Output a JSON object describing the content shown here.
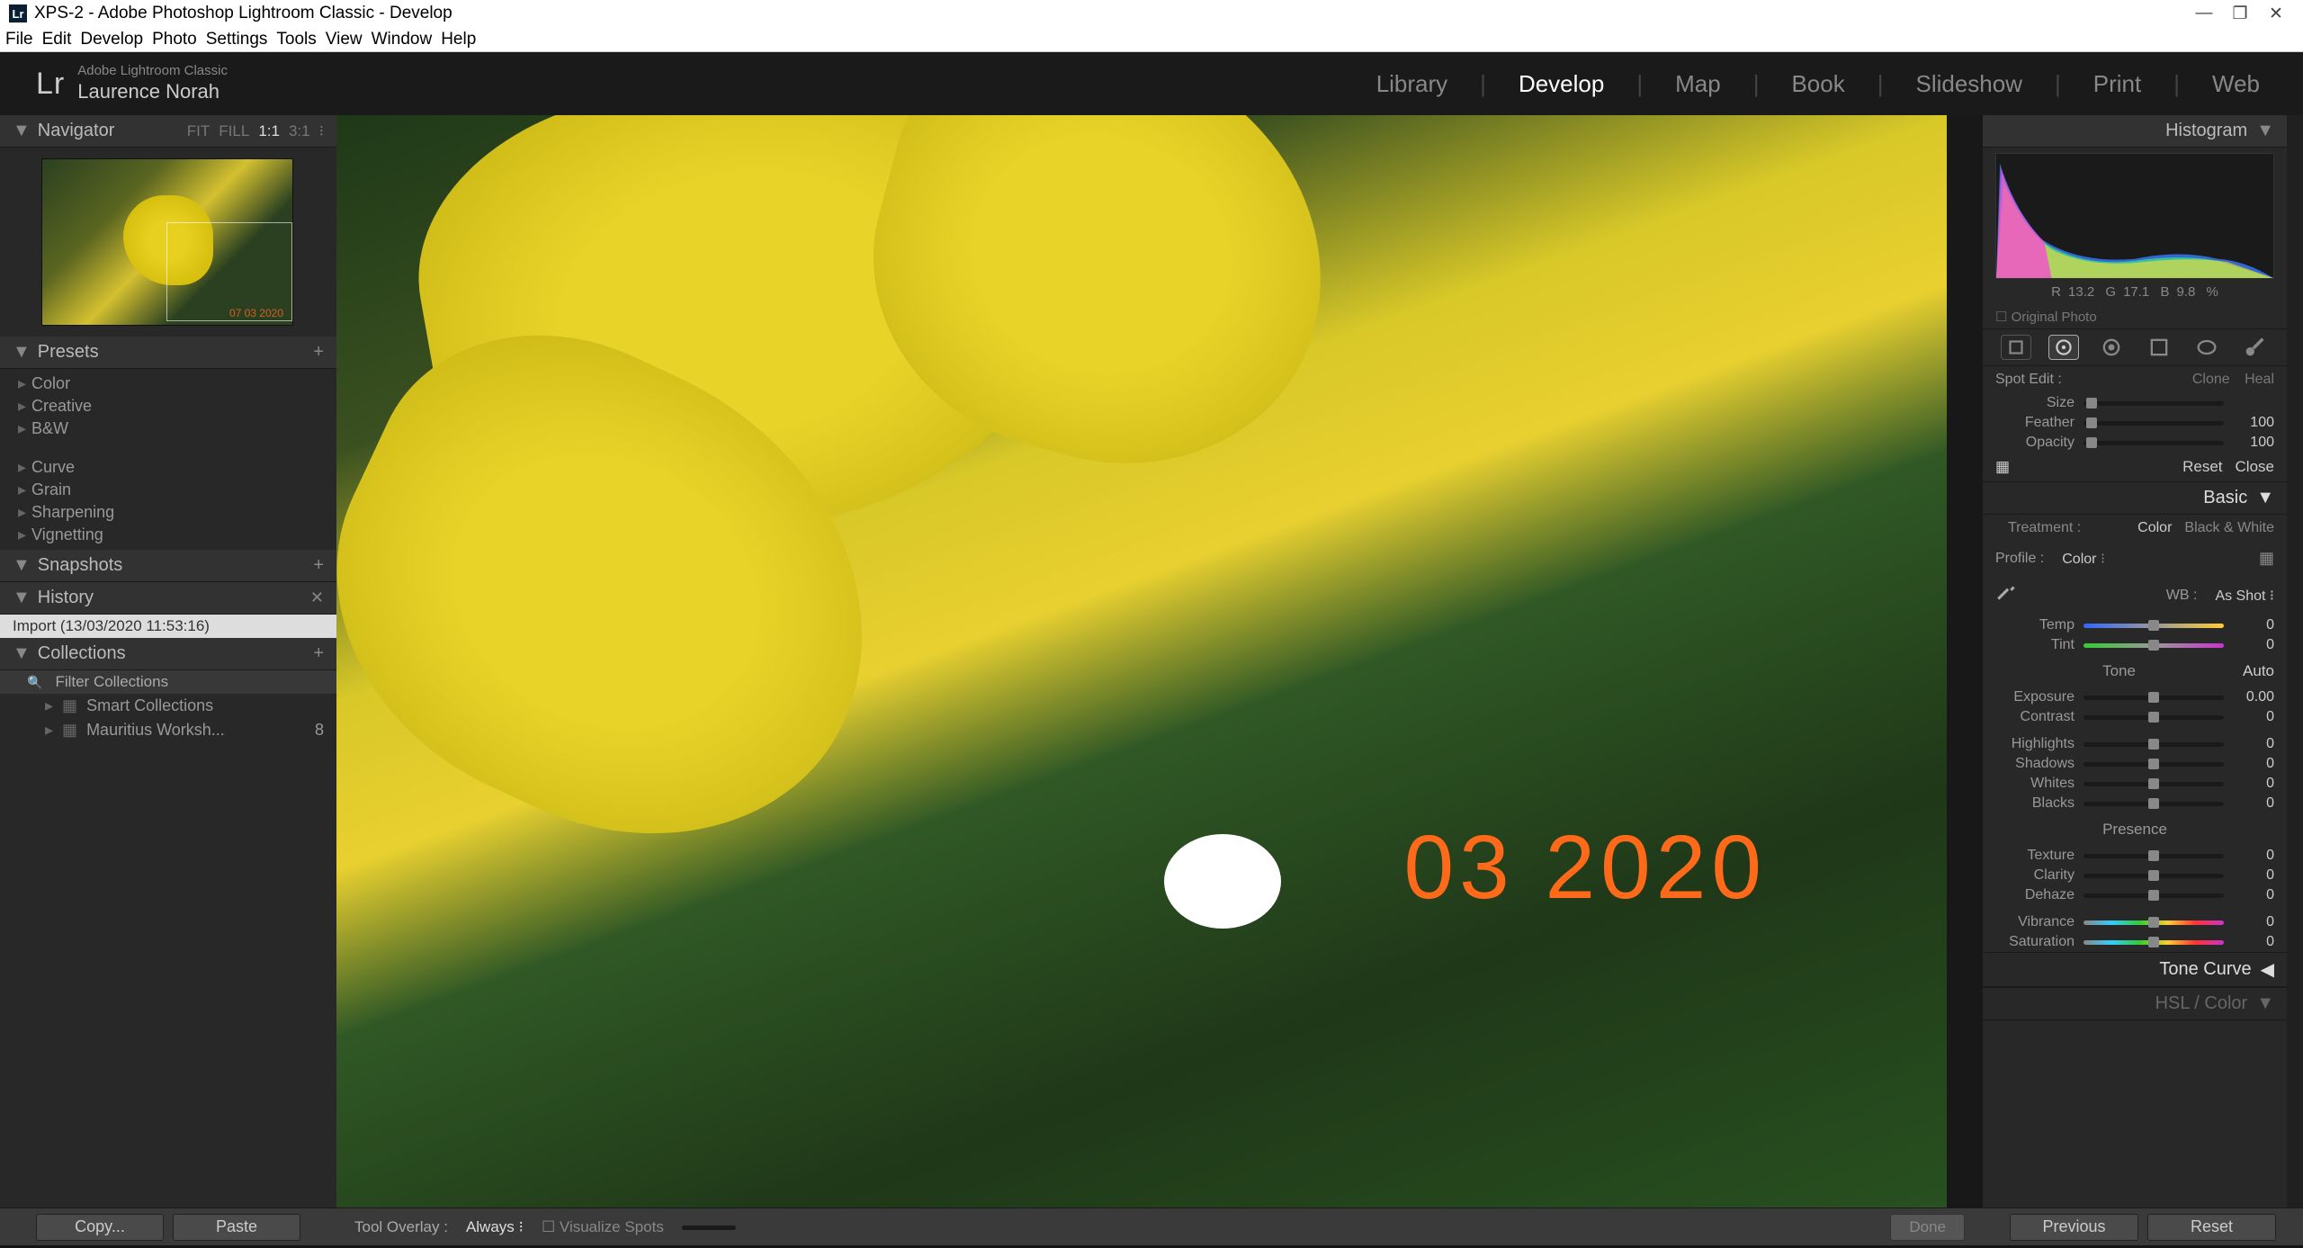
{
  "window": {
    "title": "XPS-2 - Adobe Photoshop Lightroom Classic - Develop"
  },
  "menubar": [
    "File",
    "Edit",
    "Develop",
    "Photo",
    "Settings",
    "Tools",
    "View",
    "Window",
    "Help"
  ],
  "brand": {
    "logo": "Lr",
    "line1": "Adobe Lightroom Classic",
    "line2": "Laurence Norah"
  },
  "modules": {
    "items": [
      "Library",
      "Develop",
      "Map",
      "Book",
      "Slideshow",
      "Print",
      "Web"
    ],
    "active": "Develop"
  },
  "navigator": {
    "title": "Navigator",
    "zoom": [
      "FIT",
      "FILL",
      "1:1",
      "3:1"
    ]
  },
  "thumb_date": "07 03 2020",
  "presets": {
    "title": "Presets",
    "groups": [
      "Color",
      "Creative",
      "B&W"
    ],
    "groups2": [
      "Curve",
      "Grain",
      "Sharpening",
      "Vignetting"
    ]
  },
  "snapshots": {
    "title": "Snapshots"
  },
  "history": {
    "title": "History",
    "item": "Import (13/03/2020 11:53:16)"
  },
  "collections": {
    "title": "Collections",
    "filter": "Filter Collections",
    "items": [
      {
        "name": "Smart Collections",
        "count": ""
      },
      {
        "name": "Mauritius Worksh...",
        "count": "8"
      }
    ]
  },
  "date_overlay": "03  2020",
  "histogram": {
    "title": "Histogram",
    "rgb": {
      "r": "13.2",
      "g": "17.1",
      "b": "9.8"
    },
    "original": "Original Photo"
  },
  "spot": {
    "label": "Spot Edit :",
    "clone": "Clone",
    "heal": "Heal",
    "size": {
      "label": "Size",
      "value": ""
    },
    "feather": {
      "label": "Feather",
      "value": "100"
    },
    "opacity": {
      "label": "Opacity",
      "value": "100"
    },
    "reset": "Reset",
    "close": "Close"
  },
  "basic": {
    "title": "Basic",
    "treatment": "Treatment :",
    "color": "Color",
    "bw": "Black & White",
    "profile_label": "Profile :",
    "profile": "Color",
    "wb_label": "WB :",
    "wb": "As Shot",
    "tone": "Tone",
    "auto": "Auto",
    "sliders": [
      {
        "label": "Temp",
        "value": "0",
        "grad": "grad"
      },
      {
        "label": "Tint",
        "value": "0",
        "grad": "grad2"
      }
    ],
    "tone_sliders": [
      {
        "label": "Exposure",
        "value": "0.00"
      },
      {
        "label": "Contrast",
        "value": "0"
      }
    ],
    "tone_sliders2": [
      {
        "label": "Highlights",
        "value": "0"
      },
      {
        "label": "Shadows",
        "value": "0"
      },
      {
        "label": "Whites",
        "value": "0"
      },
      {
        "label": "Blacks",
        "value": "0"
      }
    ],
    "presence": "Presence",
    "presence_sliders": [
      {
        "label": "Texture",
        "value": "0"
      },
      {
        "label": "Clarity",
        "value": "0"
      },
      {
        "label": "Dehaze",
        "value": "0"
      }
    ],
    "color_sliders": [
      {
        "label": "Vibrance",
        "value": "0",
        "grad": "vib"
      },
      {
        "label": "Saturation",
        "value": "0",
        "grad": "vib"
      }
    ]
  },
  "tone_curve": "Tone Curve",
  "hsl": "HSL / Color",
  "bottom": {
    "copy": "Copy...",
    "paste": "Paste",
    "overlay_label": "Tool Overlay :",
    "overlay": "Always",
    "viz": "Visualize Spots",
    "done": "Done",
    "prev": "Previous",
    "reset": "Reset"
  }
}
